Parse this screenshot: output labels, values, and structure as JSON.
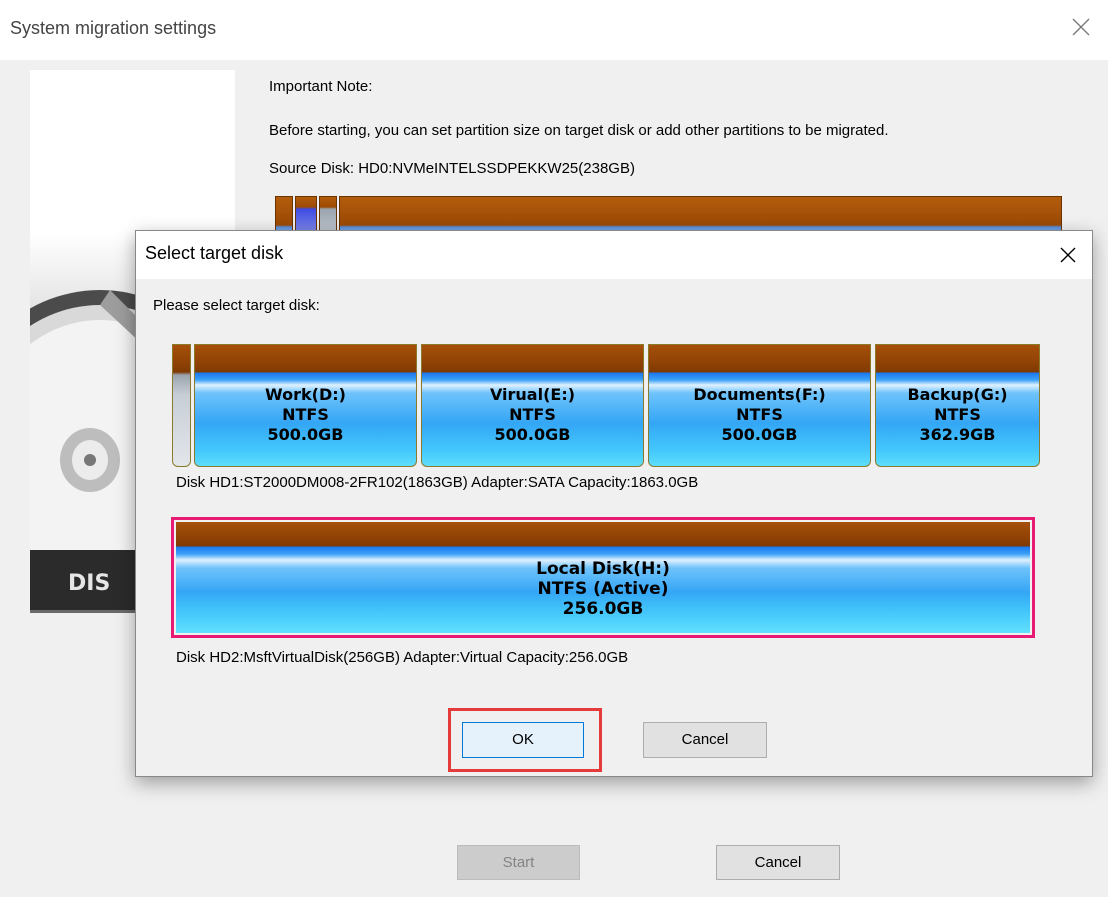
{
  "main_window": {
    "title": "System migration settings",
    "note_label": "Important Note:",
    "note_text": "Before starting, you can set partition size on target disk or add other partitions to be migrated.",
    "source_disk": "Source Disk:  HD0:NVMeINTELSSDPEKKW25(238GB)",
    "start_label": "Start",
    "cancel_label": "Cancel",
    "side_image_text": "DIS"
  },
  "dialog": {
    "title": "Select target disk",
    "prompt": "Please select target disk:",
    "ok_label": "OK",
    "cancel_label": "Cancel",
    "disks": [
      {
        "info": "Disk HD1:ST2000DM008-2FR102(1863GB)  Adapter:SATA  Capacity:1863.0GB",
        "partitions": [
          {
            "name": "Work(D:)",
            "fs": "NTFS",
            "size": "500.0GB"
          },
          {
            "name": "Virual(E:)",
            "fs": "NTFS",
            "size": "500.0GB"
          },
          {
            "name": "Documents(F:)",
            "fs": "NTFS",
            "size": "500.0GB"
          },
          {
            "name": "Backup(G:)",
            "fs": "NTFS",
            "size": "362.9GB"
          }
        ]
      },
      {
        "info": "Disk HD2:MsftVirtualDisk(256GB)  Adapter:Virtual  Capacity:256.0GB",
        "selected": true,
        "partitions": [
          {
            "name": "Local Disk(H:)",
            "fs": "NTFS (Active)",
            "size": "256.0GB"
          }
        ]
      }
    ]
  },
  "colors": {
    "selection_border": "#e81b74",
    "ok_highlight": "#e53a3a",
    "partition_header": "#9c4a05",
    "partition_body": "#34a6f5"
  }
}
